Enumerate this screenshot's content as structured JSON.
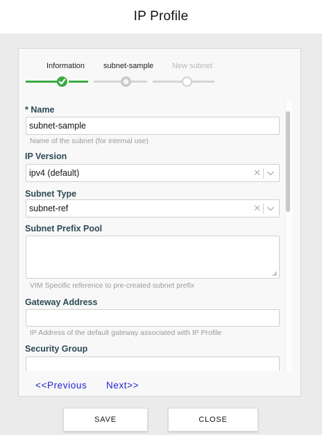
{
  "dialog": {
    "title": "IP Profile"
  },
  "stepper": {
    "steps": [
      {
        "label": "Information",
        "state": "completed"
      },
      {
        "label": "subnet-sample",
        "state": "current"
      },
      {
        "label": "New subnet",
        "state": "upcoming"
      }
    ],
    "colors": {
      "complete": "#3daa45",
      "pending": "#d4d4d4"
    }
  },
  "form": {
    "name": {
      "required_mark": "*",
      "label": "Name",
      "value": "subnet-sample",
      "hint": "Name of the subnet (for internal use)"
    },
    "ip_version": {
      "label": "IP Version",
      "value": "ipv4 (default)",
      "clear_icon": "clear-x-icon",
      "dropdown_icon": "chevron-down-icon"
    },
    "subnet_type": {
      "label": "Subnet Type",
      "value": "subnet-ref",
      "clear_icon": "clear-x-icon",
      "dropdown_icon": "chevron-down-icon"
    },
    "subnet_prefix_pool": {
      "label": "Subnet Prefix Pool",
      "value": "",
      "hint": "VIM Specific reference to pre-created subnet prefix"
    },
    "gateway_address": {
      "label": "Gateway Address",
      "value": "",
      "hint": "IP Address of the default gateway associated with IP Profile"
    },
    "security_group": {
      "label": "Security Group",
      "value": ""
    }
  },
  "pager": {
    "previous": "<<Previous",
    "next": "Next>>"
  },
  "footer": {
    "save": "SAVE",
    "close": "CLOSE"
  }
}
